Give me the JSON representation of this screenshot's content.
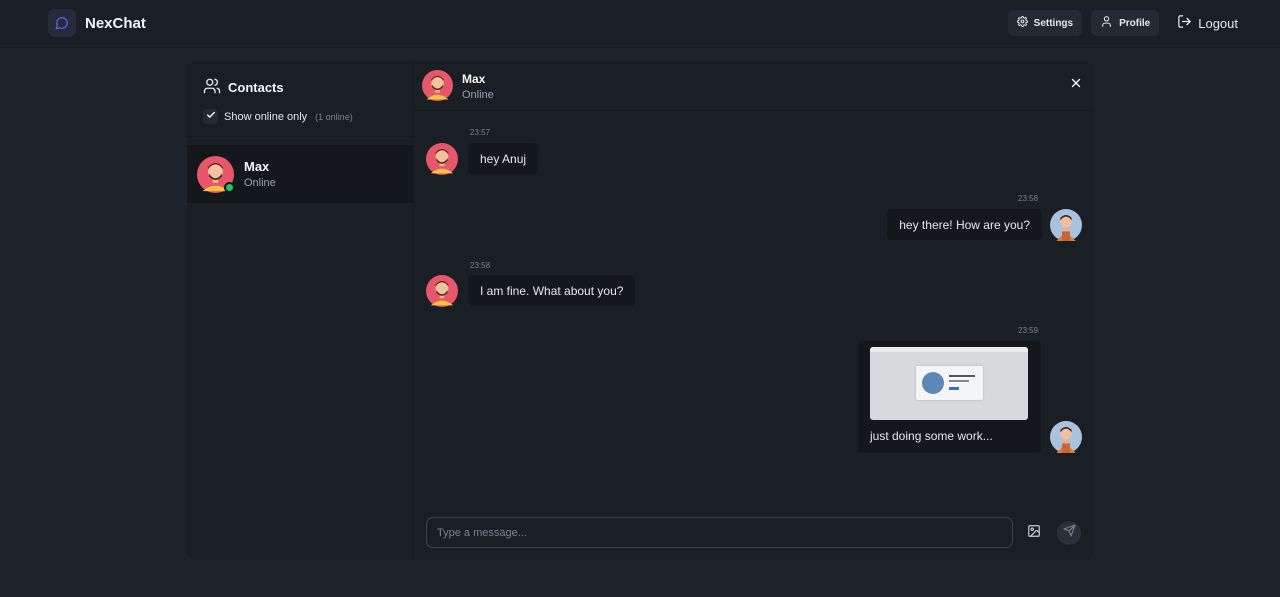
{
  "app": {
    "name": "NexChat"
  },
  "nav": {
    "settings_label": "Settings",
    "profile_label": "Profile",
    "logout_label": "Logout"
  },
  "sidebar": {
    "title": "Contacts",
    "filter_label": "Show online only",
    "online_count": "(1 online)",
    "filter_checked": true,
    "contacts": [
      {
        "name": "Max",
        "status": "Online"
      }
    ]
  },
  "chat": {
    "contact_name": "Max",
    "contact_status": "Online",
    "messages": [
      {
        "from": "contact",
        "time": "23:57",
        "text": "hey Anuj"
      },
      {
        "from": "me",
        "time": "23:58",
        "text": "hey there! How are you?"
      },
      {
        "from": "contact",
        "time": "23:58",
        "text": "I am fine. What about you?"
      },
      {
        "from": "me",
        "time": "23:59",
        "text": "just doing some work...",
        "has_image": true
      }
    ],
    "composer_placeholder": "Type a message..."
  },
  "colors": {
    "background": "#1d232a",
    "panel": "#1a1f26",
    "bubble": "#14181d",
    "online": "#22c55e",
    "brand_icon": "#6366f1"
  },
  "icons": [
    "chat-bubble-icon",
    "gear-icon",
    "user-icon",
    "logout-icon",
    "users-icon",
    "check-icon",
    "close-icon",
    "image-icon",
    "send-icon"
  ]
}
